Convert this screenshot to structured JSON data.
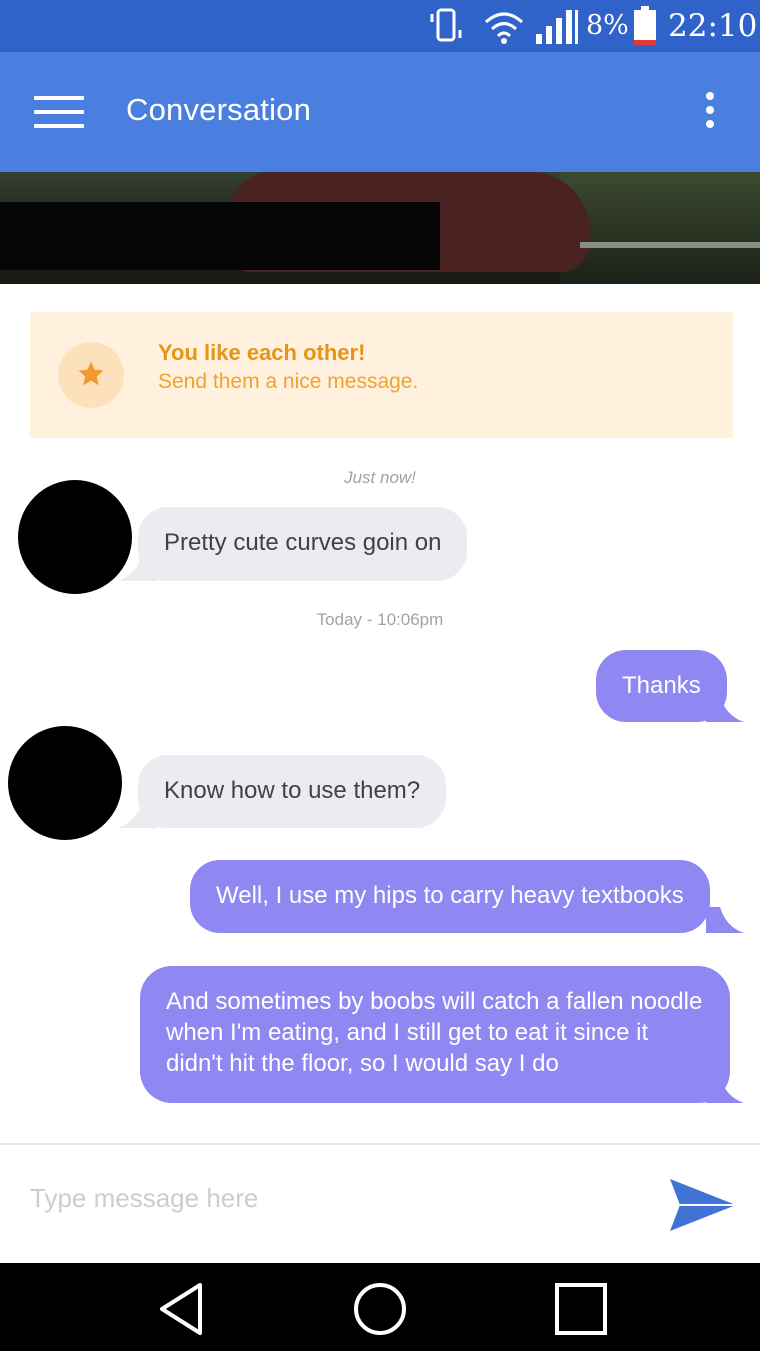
{
  "status_bar": {
    "battery_percent": "8%",
    "time": "22:10",
    "icons": [
      "vibrate-icon",
      "wifi-icon",
      "signal-icon",
      "battery-low-icon"
    ],
    "battery_level": 0.08,
    "battery_color": "#e53935"
  },
  "app_bar": {
    "title": "Conversation",
    "menu_icon": "hamburger-menu-icon",
    "overflow_icon": "more-vertical-icon",
    "color": "#4a7fe0"
  },
  "match_card": {
    "title": "You like each other!",
    "subtitle": "Send them a nice message.",
    "icon": "star-icon",
    "accent": "#e59515"
  },
  "messages": [
    {
      "type": "timestamp",
      "text": "Just now!"
    },
    {
      "type": "incoming",
      "text": "Pretty cute curves goin on"
    },
    {
      "type": "timestamp",
      "text": "Today - 10:06pm"
    },
    {
      "type": "outgoing",
      "text": "Thanks"
    },
    {
      "type": "incoming",
      "text": "Know how to use them?"
    },
    {
      "type": "outgoing",
      "text": "Well, I use my hips to carry heavy textbooks"
    },
    {
      "type": "outgoing",
      "text": "And sometimes by boobs will catch a fallen noodle when I'm eating, and I still get to eat it since it didn't hit the floor, so I would say I do"
    }
  ],
  "composer": {
    "placeholder": "Type message here",
    "value": "",
    "send_icon": "send-icon",
    "send_color": "#3f74d6"
  },
  "colors": {
    "outgoing_bubble": "#8f87f2",
    "incoming_bubble": "#ececf0"
  },
  "nav_bar": {
    "icons": [
      "back-icon",
      "home-icon",
      "recents-icon"
    ]
  }
}
